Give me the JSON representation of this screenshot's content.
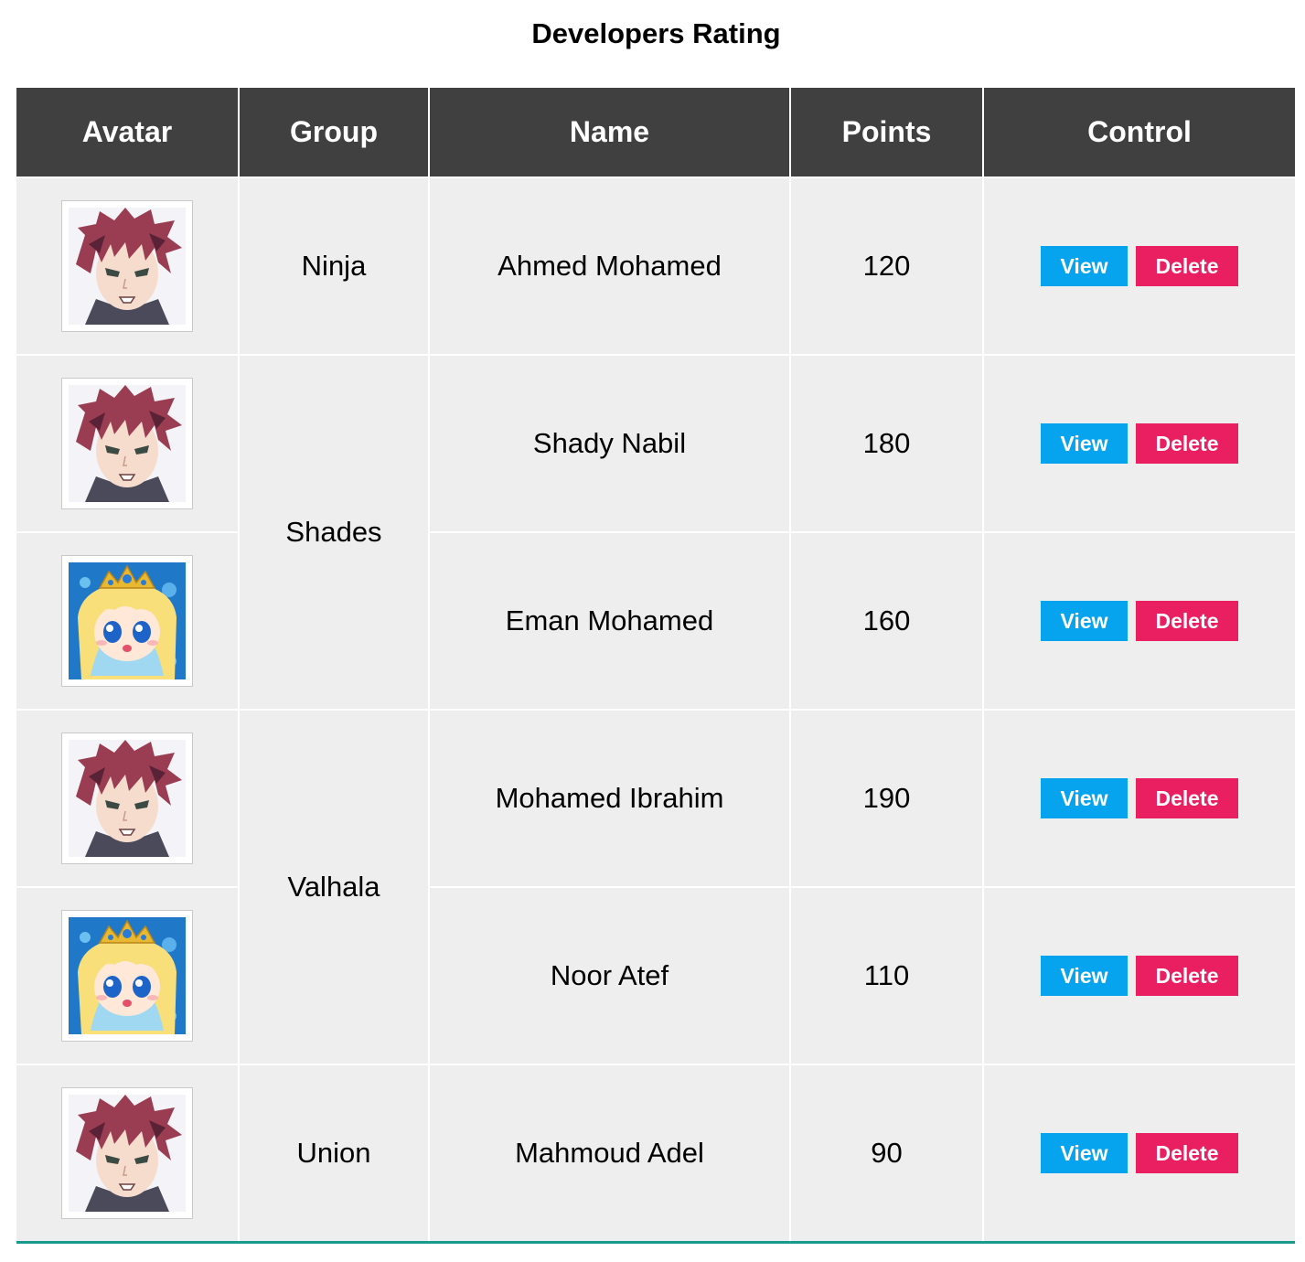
{
  "title": "Developers Rating",
  "columns": {
    "avatar": "Avatar",
    "group": "Group",
    "name": "Name",
    "points": "Points",
    "control": "Control"
  },
  "groups": [
    "Ninja",
    "Shades",
    "Valhala",
    "Union"
  ],
  "rows": [
    {
      "avatar": "male-anime-avatar",
      "name": "Ahmed Mohamed",
      "points": "120",
      "view_label": "View",
      "delete_label": "Delete"
    },
    {
      "avatar": "male-anime-avatar",
      "name": "Shady Nabil",
      "points": "180",
      "view_label": "View",
      "delete_label": "Delete"
    },
    {
      "avatar": "princess-anime-avatar",
      "name": "Eman Mohamed",
      "points": "160",
      "view_label": "View",
      "delete_label": "Delete"
    },
    {
      "avatar": "male-anime-avatar",
      "name": "Mohamed Ibrahim",
      "points": "190",
      "view_label": "View",
      "delete_label": "Delete"
    },
    {
      "avatar": "princess-anime-avatar",
      "name": "Noor Atef",
      "points": "110",
      "view_label": "View",
      "delete_label": "Delete"
    },
    {
      "avatar": "male-anime-avatar",
      "name": "Mahmoud Adel",
      "points": "90",
      "view_label": "View",
      "delete_label": "Delete"
    }
  ],
  "colors": {
    "header_bg": "#404040",
    "cell_bg": "#eeeeee",
    "view_button": "#06a4ef",
    "delete_button": "#e91f62",
    "table_bottom_border": "#1a9a8c"
  }
}
